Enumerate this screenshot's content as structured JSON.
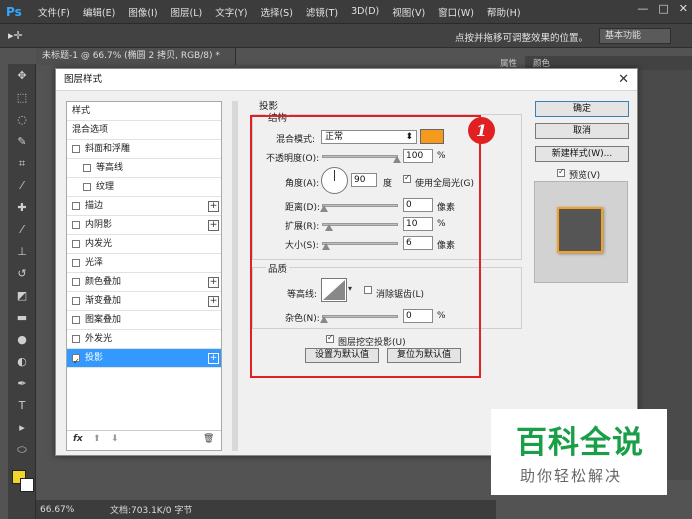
{
  "app": {
    "logo": "Ps"
  },
  "menubar": [
    "文件(F)",
    "编辑(E)",
    "图像(I)",
    "图层(L)",
    "文字(Y)",
    "选择(S)",
    "滤镜(T)",
    "3D(D)",
    "视图(V)",
    "窗口(W)",
    "帮助(H)"
  ],
  "window_controls": {
    "minimize": "—",
    "restore": "□",
    "close": "✕"
  },
  "optbar": {
    "hint": "点按并拖移可调整效果的位置。",
    "workspace": "基本功能"
  },
  "doc_tab": "未标题-1 @ 66.7% (椭圆 2 拷贝, RGB/8) *",
  "right_panel": {
    "tabs": [
      "属性",
      "颜色"
    ]
  },
  "status": {
    "zoom": "66.67%",
    "doc": "文档:703.1K/0 字节"
  },
  "dialog": {
    "title": "图层样式",
    "styles": [
      {
        "label": "样式",
        "checkbox": false,
        "plus": false,
        "indent": 0
      },
      {
        "label": "混合选项",
        "checkbox": false,
        "plus": false,
        "indent": 0
      },
      {
        "label": "斜面和浮雕",
        "checkbox": true,
        "checked": false,
        "plus": false,
        "indent": 0
      },
      {
        "label": "等高线",
        "checkbox": true,
        "checked": false,
        "plus": false,
        "indent": 1
      },
      {
        "label": "纹理",
        "checkbox": true,
        "checked": false,
        "plus": false,
        "indent": 1
      },
      {
        "label": "描边",
        "checkbox": true,
        "checked": false,
        "plus": true,
        "indent": 0
      },
      {
        "label": "内阴影",
        "checkbox": true,
        "checked": false,
        "plus": true,
        "indent": 0
      },
      {
        "label": "内发光",
        "checkbox": true,
        "checked": false,
        "plus": false,
        "indent": 0
      },
      {
        "label": "光泽",
        "checkbox": true,
        "checked": false,
        "plus": false,
        "indent": 0
      },
      {
        "label": "颜色叠加",
        "checkbox": true,
        "checked": false,
        "plus": true,
        "indent": 0
      },
      {
        "label": "渐变叠加",
        "checkbox": true,
        "checked": false,
        "plus": true,
        "indent": 0
      },
      {
        "label": "图案叠加",
        "checkbox": true,
        "checked": false,
        "plus": false,
        "indent": 0
      },
      {
        "label": "外发光",
        "checkbox": true,
        "checked": false,
        "plus": false,
        "indent": 0
      },
      {
        "label": "投影",
        "checkbox": true,
        "checked": true,
        "plus": true,
        "indent": 0,
        "selected": true
      }
    ],
    "footer_icons": {
      "fx": "fx",
      "up": "⬆",
      "down": "⬇",
      "trash": "🗑"
    },
    "drop_shadow": {
      "heading": "投影",
      "structure": "结构",
      "blend_mode_label": "混合模式:",
      "blend_mode": "正常",
      "shadow_color": "#f49a1e",
      "opacity_label": "不透明度(O):",
      "opacity": "100",
      "opacity_unit": "%",
      "angle_label": "角度(A):",
      "angle": "90",
      "angle_unit": "度",
      "global_light_label": "使用全局光(G)",
      "global_light": true,
      "distance_label": "距离(D):",
      "distance": "0",
      "distance_unit": "像素",
      "spread_label": "扩展(R):",
      "spread": "10",
      "spread_unit": "%",
      "size_label": "大小(S):",
      "size": "6",
      "size_unit": "像素",
      "quality": "品质",
      "contour_label": "等高线:",
      "anti_alias_label": "消除锯齿(L)",
      "anti_alias": false,
      "noise_label": "杂色(N):",
      "noise": "0",
      "noise_unit": "%",
      "knockout_label": "图层挖空投影(U)",
      "knockout": true,
      "set_default": "设置为默认值",
      "reset_default": "复位为默认值"
    },
    "buttons": {
      "ok": "确定",
      "cancel": "取消",
      "new_style": "新建样式(W)...",
      "preview": "预览(V)"
    },
    "preview_checked": true,
    "annotation_number": "1"
  },
  "watermark": {
    "title": "百科全说",
    "subtitle": "助你轻松解决"
  },
  "colors": {
    "accent": "#e12121",
    "selection": "#3399ff",
    "shadow": "#f49a1e",
    "watermark_green": "#1a9e47"
  }
}
